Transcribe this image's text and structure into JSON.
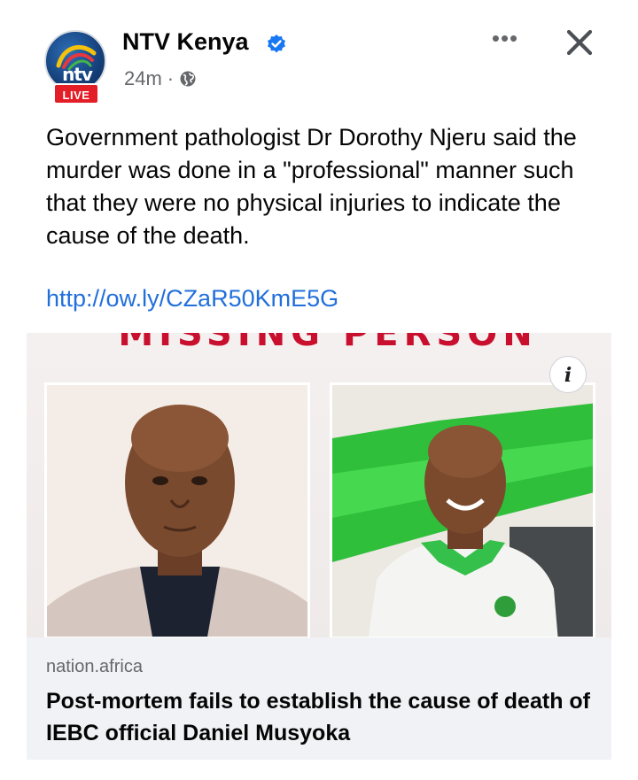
{
  "post": {
    "page_name": "NTV Kenya",
    "time": "24m",
    "separator": "·",
    "avatar_brand": "ntv",
    "live_label": "LIVE",
    "more_label": "•••",
    "text": "Government pathologist Dr Dorothy Njeru said the murder was done in a \"professional\" manner such that they were no physical injuries to indicate the cause of the death.",
    "link": "http://ow.ly/CZaR50KmE5G"
  },
  "card": {
    "banner": "MISSING PERSON",
    "info_label": "i",
    "domain": "nation.africa",
    "headline": "Post-mortem fails to establish the cause of death of IEBC official Daniel Musyoka"
  },
  "icons": {
    "verified": "verified-badge-icon",
    "globe": "globe-icon",
    "more": "more-options-icon",
    "close": "close-icon",
    "info": "info-icon"
  },
  "colors": {
    "accent_blue": "#1877f2",
    "link_blue": "#216fdb",
    "live_red": "#e41e26",
    "banner_red": "#c8102e",
    "muted": "#65676b"
  }
}
